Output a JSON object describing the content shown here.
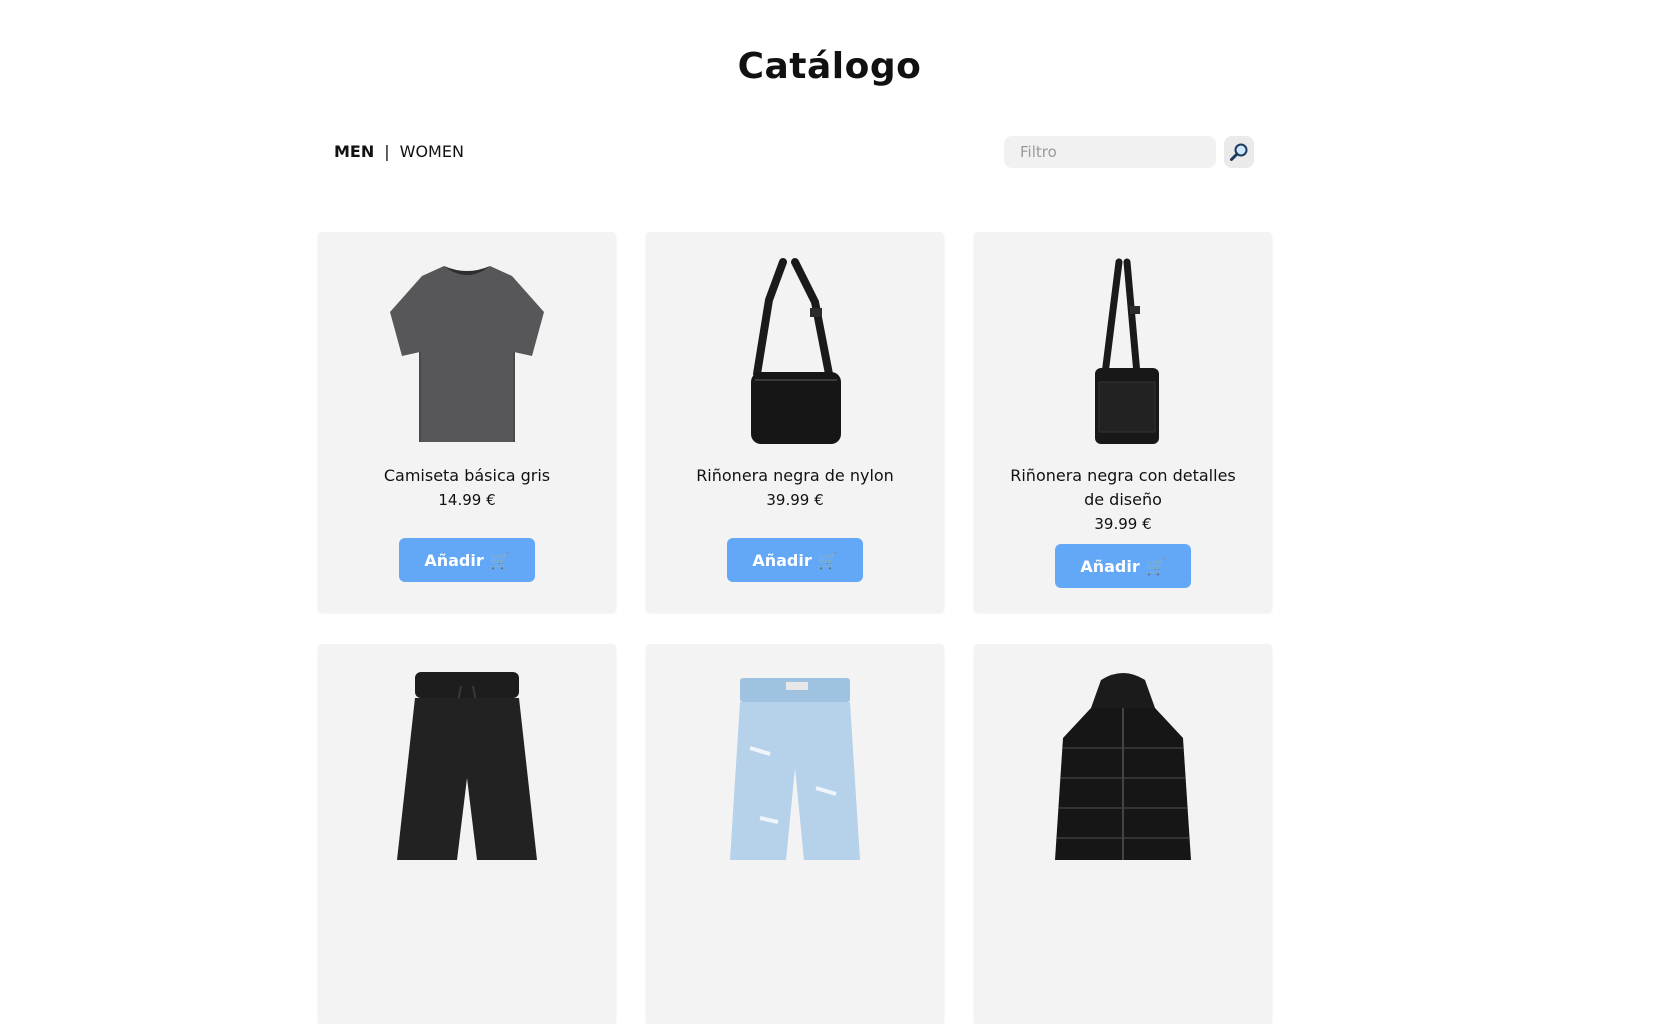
{
  "header": {
    "title": "Catálogo"
  },
  "nav": {
    "men": "MEN",
    "separator": "|",
    "women": "WOMEN"
  },
  "search": {
    "placeholder": "Filtro",
    "icon": "magnifier-icon"
  },
  "colors": {
    "button": "#63a7f7",
    "card": "#f3f3f3",
    "input": "#f1f1f1"
  },
  "products": [
    {
      "name": "Camiseta básica gris",
      "price": "14.99 €",
      "button": "Añadir",
      "image": "tshirt-image"
    },
    {
      "name": "Riñonera negra de nylon",
      "price": "39.99 €",
      "button": "Añadir",
      "image": "crossbody-bag-image"
    },
    {
      "name": "Riñonera negra con detalles de diseño",
      "price": "39.99 €",
      "button": "Añadir",
      "image": "flat-bag-image"
    },
    {
      "image": "black-shorts-image"
    },
    {
      "image": "denim-shorts-image"
    },
    {
      "image": "puffer-jacket-image"
    }
  ],
  "cart_icon": "🛒"
}
